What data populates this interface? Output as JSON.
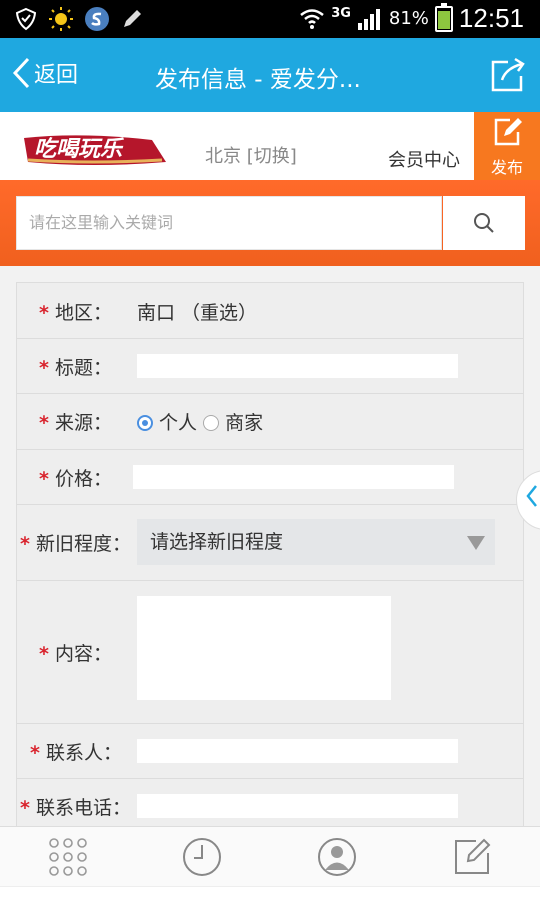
{
  "status_bar": {
    "network": "3G",
    "battery": "81%",
    "time": "12:51",
    "icons": [
      "shield-icon",
      "sun-icon",
      "browser-icon",
      "pen-icon",
      "wifi-icon",
      "signal-icon",
      "battery-icon"
    ]
  },
  "app_bar": {
    "back_label": "返回",
    "title": "发布信息 - 爱发分...",
    "share_icon": "share-icon"
  },
  "site_header": {
    "logo_text": "吃喝玩乐",
    "city": "北京 [切换]",
    "member_center": "会员中心",
    "publish_label": "发布"
  },
  "search": {
    "placeholder": "请在这里输入关键词"
  },
  "form": {
    "region": {
      "label": "地区：",
      "value": "南口 （重选）"
    },
    "title": {
      "label": "标题：",
      "value": ""
    },
    "source": {
      "label": "来源：",
      "options": [
        "个人",
        "商家"
      ],
      "selected": "个人"
    },
    "price": {
      "label": "价格：",
      "value": ""
    },
    "condition": {
      "label": "新旧程度：",
      "value": "请选择新旧程度"
    },
    "content": {
      "label": "内容：",
      "value": ""
    },
    "contact": {
      "label": "联系人：",
      "value": ""
    },
    "phone": {
      "label": "联系电话：",
      "value": ""
    },
    "required_mark": "*"
  },
  "bottom_nav": {
    "icons": [
      "grid-icon",
      "clock-icon",
      "user-icon",
      "edit-icon"
    ]
  },
  "colors": {
    "app_bar": "#1fa8e0",
    "brand_orange": "#f7781f",
    "required": "#d9232d",
    "radio_selected": "#4a8fe0"
  }
}
